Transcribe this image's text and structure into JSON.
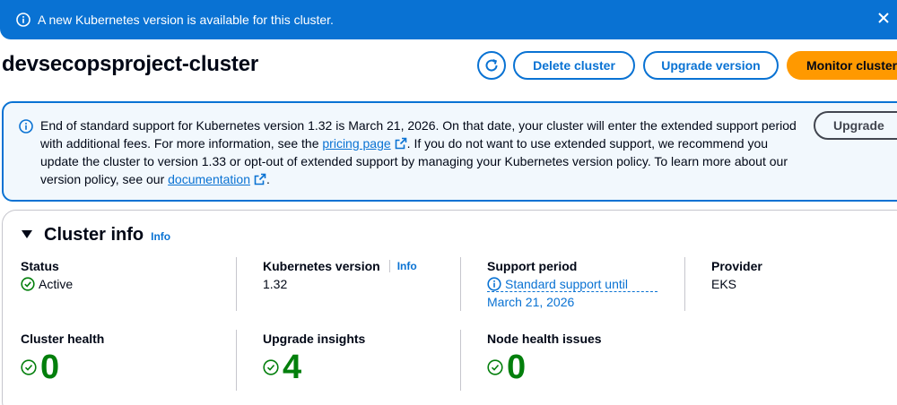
{
  "flash": {
    "message": "A new Kubernetes version is available for this cluster.",
    "icon": "info-icon",
    "close_icon": "close-icon"
  },
  "header": {
    "title": "devsecopsproject-cluster",
    "refresh_icon": "refresh-icon",
    "delete_label": "Delete cluster",
    "upgrade_label": "Upgrade version",
    "monitor_label": "Monitor cluster"
  },
  "alert": {
    "text_1": "End of standard support for Kubernetes version 1.32 is March 21, 2026. On that date, your cluster will enter the extended support period with additional fees. For more information, see the ",
    "link_1": "pricing page",
    "text_2": ". If you do not want to use extended support, we recommend you update the cluster to version 1.33 or opt-out of extended support by managing your Kubernetes version policy. To learn more about our version policy, see our ",
    "link_2": "documentation",
    "text_3": ".",
    "button_label": "Upgrade"
  },
  "cluster_info": {
    "title": "Cluster info",
    "info_label": "Info",
    "status_label": "Status",
    "status_value": "Active",
    "k8s_label": "Kubernetes version",
    "k8s_info": "Info",
    "k8s_value": "1.32",
    "support_label": "Support period",
    "support_value": "Standard support until March 21, 2026",
    "provider_label": "Provider",
    "provider_value": "EKS",
    "health_label": "Cluster health",
    "health_value": "0",
    "insights_label": "Upgrade insights",
    "insights_value": "4",
    "node_label": "Node health issues",
    "node_value": "0"
  },
  "colors": {
    "primary_blue": "#0972d3",
    "orange": "#ff9900",
    "success_green": "#037f0c"
  }
}
